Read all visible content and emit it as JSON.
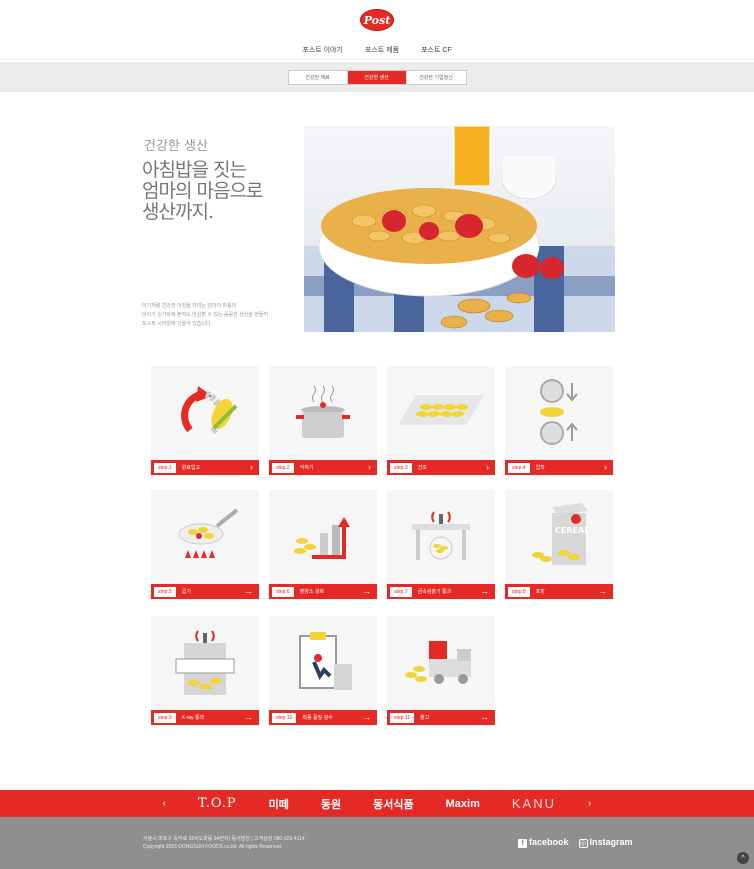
{
  "brand": {
    "logo_text": "Post",
    "logo_color": "#e52a26"
  },
  "topnav": {
    "items": [
      "포스트 이야기",
      "포스트 제품",
      "포스트 CF"
    ]
  },
  "subtabs": {
    "items": [
      "건강한 재료",
      "건강한 생산",
      "건강한 기업정신"
    ],
    "active_index": 1
  },
  "hero": {
    "small_title": "건강한 생산",
    "big_title": [
      "아침밥을 짓는",
      "엄마의 마음으로",
      "생산까지."
    ],
    "desc": [
      "아기처럼 건강한 아침을 차리는 엄마의 마음이",
      "아이가 손가락에 붙여도 안심할 수 있는 꼼꼼한 생산을 만들어",
      "포스트 시리얼에 깃들어 있습니다."
    ],
    "image_label": "cereal-bowl-with-strawberries"
  },
  "steps": [
    {
      "num": "step.1",
      "name": "원료입고",
      "icon": "corn-recycle-icon"
    },
    {
      "num": "step.2",
      "name": "익히기",
      "icon": "cooking-pot-icon"
    },
    {
      "num": "step.3",
      "name": "건조",
      "icon": "drying-tray-icon"
    },
    {
      "num": "step.4",
      "name": "압착",
      "icon": "roller-press-icon"
    },
    {
      "num": "step.5",
      "name": "굽기",
      "icon": "roasting-pan-icon"
    },
    {
      "num": "step.6",
      "name": "영양소 강화",
      "icon": "nutrition-chart-icon"
    },
    {
      "num": "step.7",
      "name": "금속검출기 통과",
      "icon": "metal-detector-icon"
    },
    {
      "num": "step.8",
      "name": "포장",
      "icon": "cereal-box-icon"
    },
    {
      "num": "step.9",
      "name": "X-ray 통과",
      "icon": "xray-scan-icon"
    },
    {
      "num": "step.10",
      "name": "최종 품질 검수",
      "icon": "clipboard-inspection-icon"
    },
    {
      "num": "step.11",
      "name": "출고",
      "icon": "delivery-truck-icon"
    }
  ],
  "brandbar": {
    "prev": "‹",
    "next": "›",
    "brands": [
      "T.O.P",
      "미떼",
      "동원",
      "동서식품",
      "Maxim",
      "KANU"
    ]
  },
  "footer": {
    "address": "서울시 마포구 독막로 324(도화동 54번지) 동서빌딩  |  고객상담 080-023-4114",
    "copyright": "Copyright 2015 DONGSUH FOODS co.ltd. All rights Reserved.",
    "facebook": "facebook",
    "instagram": "Instagram",
    "to_top": "^"
  }
}
